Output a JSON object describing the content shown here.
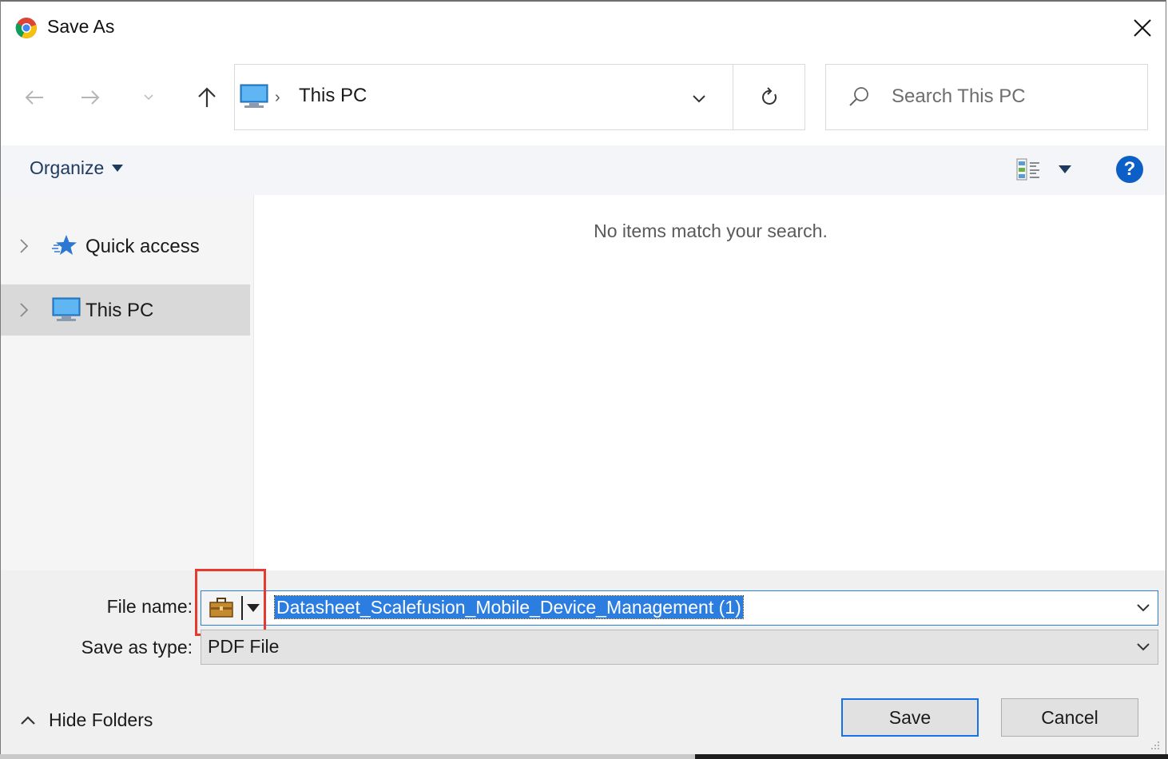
{
  "window": {
    "title": "Save As",
    "app_icon": "chrome-icon"
  },
  "navigation": {
    "back_icon": "back-arrow-icon",
    "forward_icon": "forward-arrow-icon",
    "recent_icon": "chevron-down-icon",
    "up_icon": "up-arrow-icon"
  },
  "address_bar": {
    "location_icon": "computer-icon",
    "location": "This PC"
  },
  "search": {
    "placeholder": "Search This PC"
  },
  "toolbar": {
    "organize_label": "Organize",
    "help_label": "?"
  },
  "sidebar": {
    "items": [
      {
        "label": "Quick access",
        "icon": "star-icon",
        "selected": false
      },
      {
        "label": "This PC",
        "icon": "computer-icon",
        "selected": true
      }
    ]
  },
  "content": {
    "empty_message": "No items match your search."
  },
  "form": {
    "file_name_label": "File name:",
    "file_name_value": "Datasheet_Scalefusion_Mobile_Device_Management (1)",
    "save_type_label": "Save as type:",
    "save_type_value": "PDF File"
  },
  "footer": {
    "hide_folders_label": "Hide Folders",
    "save_label": "Save",
    "cancel_label": "Cancel"
  },
  "colors": {
    "accent": "#0b5fc6",
    "selection": "#2b7de0",
    "highlight_box": "#e63a2e"
  }
}
